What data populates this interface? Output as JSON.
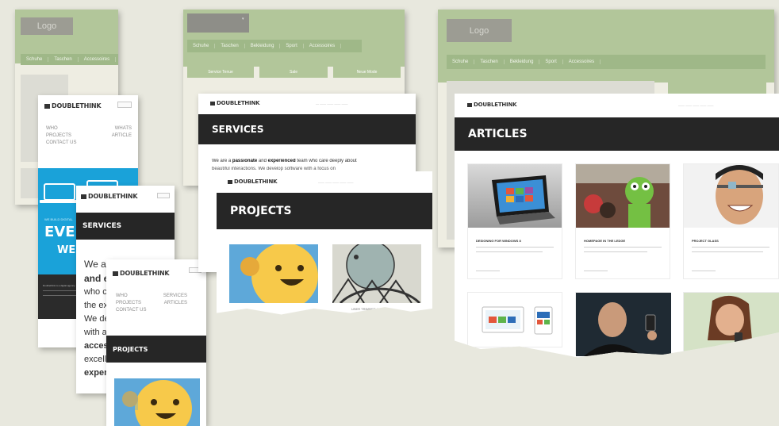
{
  "wireframe_left": {
    "logo": "Logo",
    "nav": [
      "Schuhe",
      "Taschen",
      "Accessoires"
    ]
  },
  "wireframe_mid": {
    "nav": [
      "Schuhe",
      "Taschen",
      "Bekleidung",
      "Sport",
      "Accessoires"
    ],
    "buttons": [
      "Service Tenue",
      "Sale",
      "Neue Mode"
    ]
  },
  "wireframe_right": {
    "logo": "Logo",
    "nav": [
      "Schuhe",
      "Taschen",
      "Bekleidung",
      "Sport",
      "Accessoires"
    ]
  },
  "brand": "DOUBLETHINK",
  "phone_home": {
    "links": [
      "WHO",
      "WHATS",
      "PROJECTS",
      "ARTICLE",
      "CONTACT US"
    ],
    "hero_line1": "WE BUILD DIGITAL",
    "hero_word": "EVERY",
    "hero_word2": "WE",
    "footer": "Doublethink is a digital agency"
  },
  "phone_services": {
    "title": "SERVICES",
    "lines": [
      "We ar",
      "and ex",
      "who c",
      "the ex",
      "We de",
      "with a",
      "access",
      "excell",
      "experi"
    ]
  },
  "phone_projects": {
    "links": [
      "WHO",
      "SERVICES",
      "PROJECTS",
      "ARTICLES",
      "CONTACT US"
    ],
    "title": "PROJECTS"
  },
  "services_page": {
    "title": "SERVICES",
    "text_plain1": "We are a ",
    "text_bold1": "passionate",
    "text_plain2": " and ",
    "text_bold2": "experienced",
    "text_plain3": " team who care deeply about",
    "text_line2": "beautiful interactions. We develop software with a focus on"
  },
  "projects_page": {
    "title": "PROJECTS",
    "caption": "USER TRIMMED SEND"
  },
  "articles_page": {
    "title": "ARTICLES",
    "cards": [
      {
        "title": "DESIGNING FOR WINDOWS 8"
      },
      {
        "title": "HOMEPAGE IN THE LEDGE"
      },
      {
        "title": "PROJECT GLASS"
      }
    ]
  },
  "colors": {
    "wire_green": "#b2c69a",
    "dark_band": "#262626",
    "sun_yellow": "#f7c94a",
    "sky_blue": "#5ea8d9"
  }
}
